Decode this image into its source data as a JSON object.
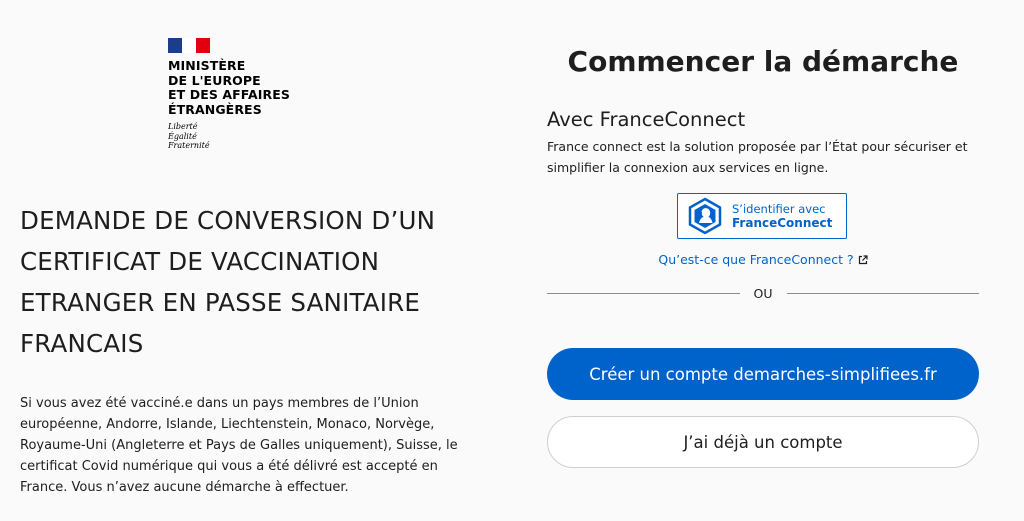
{
  "logo": {
    "ministry_lines": "MINISTÈRE\nDE L'EUROPE\nET DES AFFAIRES\nÉTRANGÈRES",
    "motto": [
      "Liberté",
      "Égalité",
      "Fraternité"
    ],
    "flag_colors": [
      "#1a3e8c",
      "#ffffff",
      "#e1000f"
    ]
  },
  "main": {
    "title": "DEMANDE DE CONVERSION D’UN CERTIFICAT DE VACCINATION ETRANGER EN PASSE SANITAIRE FRANCAIS",
    "intro": "Si vous avez été vacciné.e dans un pays membres de l’Union européenne, Andorre, Islande, Liechtenstein, Monaco, Norvège, Royaume-Uni (Angleterre et Pays de Galles uniquement), Suisse, le certificat Covid numérique qui vous a été délivré est accepté en France. Vous n’avez aucune démarche à effectuer."
  },
  "login": {
    "title": "Commencer la démarche",
    "franceconnect": {
      "heading": "Avec FranceConnect",
      "description": "France connect est la solution proposée par l’État pour sécuriser et simplifier la connexion aux services en ligne.",
      "button_line1": "S’identifier avec",
      "button_line2": "FranceConnect",
      "help_link": "Qu’est-ce que FranceConnect ?",
      "logo_icon": "franceconnect-logo-icon",
      "external_icon": "external-link-icon"
    },
    "separator": "OU",
    "create_account_label": "Créer un compte demarches-simplifiees.fr",
    "existing_account_label": "J’ai déjà un compte"
  },
  "colors": {
    "accent": "#0063cb",
    "text": "#1e1e1e",
    "background": "#fafafa"
  }
}
